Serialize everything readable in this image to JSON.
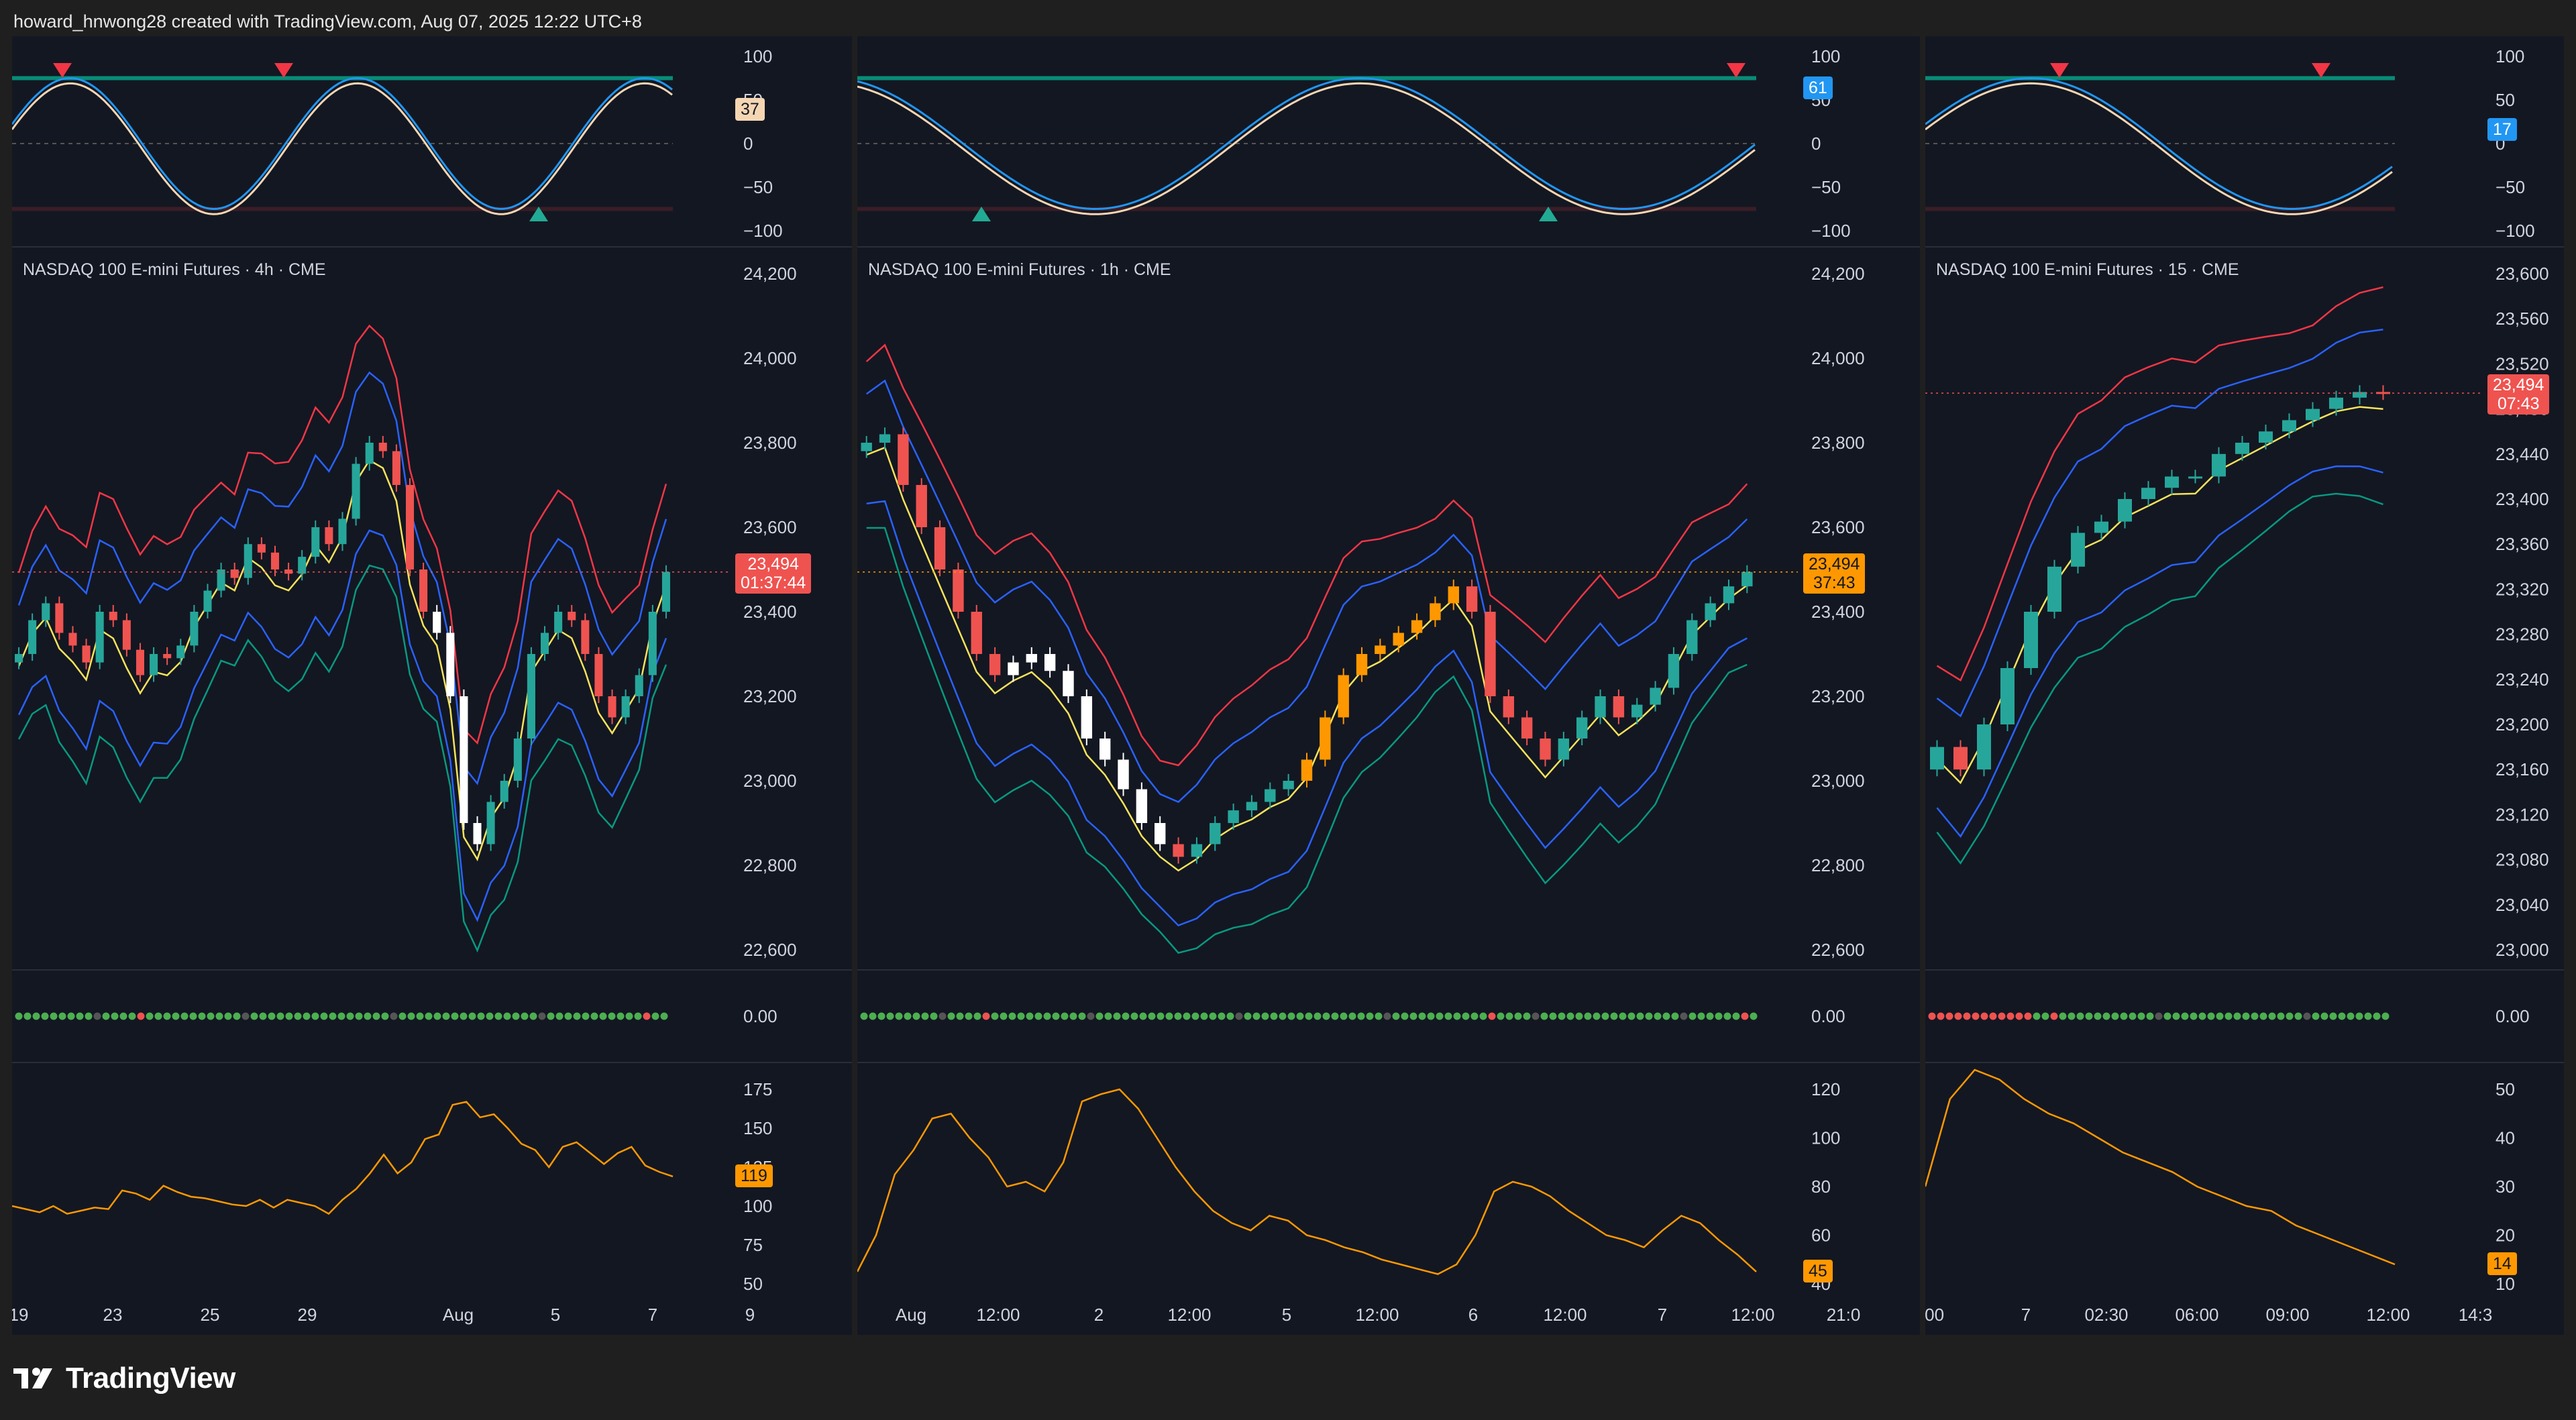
{
  "header": {
    "text": "howard_hnwong28 created with TradingView.com, Aug 07, 2025 12:22 UTC+8"
  },
  "footer": {
    "brand": "TradingView"
  },
  "colors": {
    "up": "#26a69a",
    "down": "#ef5350",
    "bb_upper": "#f23645",
    "bb_lower": "#089981",
    "basis": "#f7e35a",
    "inner": "#2962ff",
    "amber": "#ff9800",
    "white": "#ffffff",
    "signal_green": "#089981",
    "signal_red": "#f23645"
  },
  "panels": [
    {
      "id": "4h",
      "title": "NASDAQ 100 E-mini Futures · 4h · CME",
      "osc_ticks": [
        "100",
        "50",
        "0",
        "−50",
        "−100"
      ],
      "osc_value": "37",
      "osc_value_color": "#f5d6b3",
      "price_ticks": [
        "24,200",
        "24,000",
        "23,800",
        "23,600",
        "23,400",
        "23,200",
        "23,000",
        "22,800",
        "22,600"
      ],
      "price_badge": [
        "23,494",
        "01:37:44"
      ],
      "price_badge_color": "#ef5350",
      "dots_value": "0.00",
      "vol_ticks": [
        "175",
        "150",
        "125",
        "100",
        "75",
        "50"
      ],
      "vol_value": "119",
      "x_ticks": [
        "19",
        "23",
        "25",
        "29",
        "Aug",
        "5",
        "7",
        "9"
      ]
    },
    {
      "id": "1h",
      "title": "NASDAQ 100 E-mini Futures · 1h · CME",
      "osc_ticks": [
        "100",
        "50",
        "0",
        "−50",
        "−100"
      ],
      "osc_value": "61",
      "osc_value_color": "#2196f3",
      "price_ticks": [
        "24,200",
        "24,000",
        "23,800",
        "23,600",
        "23,400",
        "23,200",
        "23,000",
        "22,800",
        "22,600"
      ],
      "price_badge": [
        "23,494",
        "37:43"
      ],
      "price_badge_color": "#ff9800",
      "dots_value": "0.00",
      "vol_ticks": [
        "120",
        "100",
        "80",
        "60",
        "40"
      ],
      "vol_value": "45",
      "x_ticks": [
        "Aug",
        "12:00",
        "2",
        "12:00",
        "5",
        "12:00",
        "6",
        "12:00",
        "7",
        "12:00",
        "21:0"
      ]
    },
    {
      "id": "15m",
      "title": "NASDAQ 100 E-mini Futures · 15 · CME",
      "osc_ticks": [
        "100",
        "50",
        "0",
        "−50",
        "−100"
      ],
      "osc_value": "17",
      "osc_value_color": "#2196f3",
      "price_ticks": [
        "23,600",
        "23,560",
        "23,520",
        "23,480",
        "23,440",
        "23,400",
        "23,360",
        "23,320",
        "23,280",
        "23,240",
        "23,200",
        "23,160",
        "23,120",
        "23,080",
        "23,040",
        "23,000"
      ],
      "price_badge": [
        "23,494",
        "07:43"
      ],
      "price_badge_color": "#ef5350",
      "dots_value": "0.00",
      "vol_ticks": [
        "50",
        "40",
        "30",
        "20",
        "10"
      ],
      "vol_value": "14",
      "x_ticks": [
        ":00",
        "7",
        "02:30",
        "06:00",
        "09:00",
        "12:00",
        "14:3"
      ]
    }
  ],
  "series": {
    "4h": {
      "close": [
        23300,
        23380,
        23420,
        23350,
        23320,
        23280,
        23400,
        23380,
        23310,
        23250,
        23300,
        23290,
        23320,
        23400,
        23450,
        23500,
        23480,
        23560,
        23540,
        23500,
        23490,
        23530,
        23600,
        23560,
        23620,
        23750,
        23800,
        23780,
        23700,
        23500,
        23400,
        23350,
        23200,
        22900,
        22850,
        22950,
        23000,
        23100,
        23300,
        23350,
        23400,
        23380,
        23300,
        23200,
        23150,
        23200,
        23250,
        23400,
        23494
      ],
      "volume": [
        100,
        98,
        96,
        100,
        95,
        97,
        99,
        98,
        110,
        108,
        104,
        113,
        109,
        106,
        105,
        103,
        101,
        100,
        104,
        99,
        104,
        102,
        100,
        95,
        104,
        111,
        121,
        133,
        121,
        128,
        143,
        146,
        165,
        167,
        157,
        159,
        150,
        140,
        136,
        125,
        138,
        141,
        134,
        127,
        134,
        138,
        126,
        122,
        119
      ]
    },
    "1h": {
      "close": [
        23800,
        23820,
        23700,
        23600,
        23500,
        23400,
        23300,
        23250,
        23280,
        23300,
        23260,
        23200,
        23100,
        23050,
        22980,
        22900,
        22850,
        22820,
        22850,
        22900,
        22930,
        22950,
        22980,
        23000,
        23050,
        23150,
        23250,
        23300,
        23320,
        23350,
        23380,
        23420,
        23460,
        23400,
        23200,
        23150,
        23100,
        23050,
        23100,
        23150,
        23200,
        23150,
        23180,
        23220,
        23300,
        23380,
        23420,
        23460,
        23494
      ],
      "volume": [
        45,
        60,
        85,
        95,
        108,
        110,
        100,
        92,
        80,
        82,
        78,
        90,
        115,
        118,
        120,
        112,
        100,
        88,
        78,
        70,
        65,
        62,
        68,
        66,
        60,
        58,
        55,
        53,
        50,
        48,
        46,
        44,
        48,
        60,
        78,
        82,
        80,
        76,
        70,
        65,
        60,
        58,
        55,
        62,
        68,
        65,
        58,
        52,
        45
      ]
    },
    "15m": {
      "close": [
        23180,
        23160,
        23200,
        23250,
        23300,
        23340,
        23370,
        23380,
        23400,
        23410,
        23420,
        23420,
        23440,
        23450,
        23460,
        23470,
        23480,
        23490,
        23495,
        23494
      ],
      "volume": [
        30,
        48,
        54,
        52,
        48,
        45,
        43,
        40,
        37,
        35,
        33,
        30,
        28,
        26,
        25,
        22,
        20,
        18,
        16,
        14
      ]
    }
  }
}
